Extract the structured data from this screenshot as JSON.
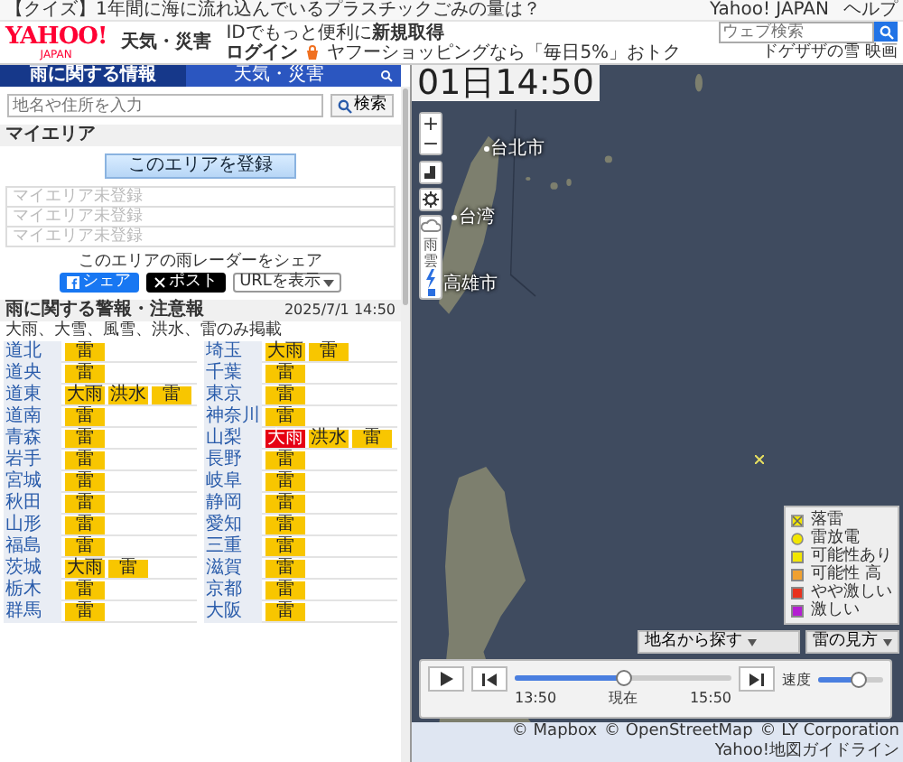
{
  "top_bar": {
    "headline": "【クイズ】1年間に海に流れ込んでいるプラスチックごみの量は？",
    "links": [
      "Yahoo! JAPAN",
      "ヘルプ"
    ]
  },
  "header": {
    "logo": "YAHOO!",
    "logo_sub": "JAPAN",
    "service": "天気・災害",
    "promo": "IDでもっと便利に",
    "promo_link": "新規取得",
    "login": "ログイン",
    "shopping": "ヤフーショッピングなら「毎日5%」おトク",
    "search": {
      "placeholder": "ウェブ検索",
      "suggestion": "ドゲザザの雪 映画"
    }
  },
  "sidebar": {
    "tabs": [
      {
        "label": "雨に関する情報",
        "selected": true
      },
      {
        "label": "天気・災害",
        "selected": false
      }
    ],
    "search": {
      "placeholder": "地名や住所を入力",
      "button": "検索"
    },
    "my_area": {
      "title": "マイエリア",
      "register_button": "このエリアを登録",
      "slots": [
        "マイエリア未登録",
        "マイエリア未登録",
        "マイエリア未登録"
      ]
    },
    "share": {
      "title": "このエリアの雨レーダーをシェア",
      "buttons": [
        {
          "kind": "facebook",
          "label": "シェア"
        },
        {
          "kind": "x",
          "label": "ポスト"
        },
        {
          "kind": "url",
          "label": "URLを表示"
        }
      ]
    },
    "warnings": {
      "title": "雨に関する警報・注意報",
      "timestamp": "2025/7/1 14:50",
      "note": "大雨、大雪、風雪、洪水、雷のみ掲載",
      "rows": [
        {
          "area": "道北",
          "alerts": [
            {
              "label": "雷",
              "color": "#f8c600"
            }
          ]
        },
        {
          "area": "道央",
          "alerts": [
            {
              "label": "雷",
              "color": "#f8c600"
            }
          ]
        },
        {
          "area": "道東",
          "alerts": [
            {
              "label": "大雨",
              "color": "#f8c600"
            },
            {
              "label": "洪水",
              "color": "#f8c600"
            },
            {
              "label": "雷",
              "color": "#f8c600"
            }
          ]
        },
        {
          "area": "道南",
          "alerts": [
            {
              "label": "雷",
              "color": "#f8c600"
            }
          ]
        },
        {
          "area": "青森",
          "alerts": [
            {
              "label": "雷",
              "color": "#f8c600"
            }
          ]
        },
        {
          "area": "岩手",
          "alerts": [
            {
              "label": "雷",
              "color": "#f8c600"
            }
          ]
        },
        {
          "area": "宮城",
          "alerts": [
            {
              "label": "雷",
              "color": "#f8c600"
            }
          ]
        },
        {
          "area": "秋田",
          "alerts": [
            {
              "label": "雷",
              "color": "#f8c600"
            }
          ]
        },
        {
          "area": "山形",
          "alerts": [
            {
              "label": "雷",
              "color": "#f8c600"
            }
          ]
        },
        {
          "area": "福島",
          "alerts": [
            {
              "label": "雷",
              "color": "#f8c600"
            }
          ]
        },
        {
          "area": "茨城",
          "alerts": [
            {
              "label": "大雨",
              "color": "#f8c600"
            },
            {
              "label": "雷",
              "color": "#f8c600"
            }
          ]
        },
        {
          "area": "栃木",
          "alerts": [
            {
              "label": "雷",
              "color": "#f8c600"
            }
          ]
        },
        {
          "area": "群馬",
          "alerts": [
            {
              "label": "雷",
              "color": "#f8c600"
            }
          ]
        },
        {
          "area": "埼玉",
          "alerts": [
            {
              "label": "大雨",
              "color": "#f8c600"
            },
            {
              "label": "雷",
              "color": "#f8c600"
            }
          ]
        },
        {
          "area": "千葉",
          "alerts": [
            {
              "label": "雷",
              "color": "#f8c600"
            }
          ]
        },
        {
          "area": "東京",
          "alerts": [
            {
              "label": "雷",
              "color": "#f8c600"
            }
          ]
        },
        {
          "area": "神奈川",
          "alerts": [
            {
              "label": "雷",
              "color": "#f8c600"
            }
          ]
        },
        {
          "area": "山梨",
          "alerts": [
            {
              "label": "大雨",
              "color": "#e60012"
            },
            {
              "label": "洪水",
              "color": "#f8c600"
            },
            {
              "label": "雷",
              "color": "#f8c600"
            }
          ]
        },
        {
          "area": "長野",
          "alerts": [
            {
              "label": "雷",
              "color": "#f8c600"
            }
          ]
        },
        {
          "area": "岐阜",
          "alerts": [
            {
              "label": "雷",
              "color": "#f8c600"
            }
          ]
        },
        {
          "area": "静岡",
          "alerts": [
            {
              "label": "雷",
              "color": "#f8c600"
            }
          ]
        },
        {
          "area": "愛知",
          "alerts": [
            {
              "label": "雷",
              "color": "#f8c600"
            }
          ]
        },
        {
          "area": "三重",
          "alerts": [
            {
              "label": "雷",
              "color": "#f8c600"
            }
          ]
        },
        {
          "area": "滋賀",
          "alerts": [
            {
              "label": "雷",
              "color": "#f8c600"
            }
          ]
        },
        {
          "area": "京都",
          "alerts": [
            {
              "label": "雷",
              "color": "#f8c600"
            }
          ]
        },
        {
          "area": "大阪",
          "alerts": [
            {
              "label": "雷",
              "color": "#f8c600"
            }
          ]
        }
      ]
    }
  },
  "map": {
    "time": "01日14:50",
    "zoom_buttons": [
      "+",
      "−"
    ],
    "layers": [
      {
        "kind": "rain-cloud",
        "label": "雨雲",
        "selected": false
      },
      {
        "kind": "lightning",
        "selected": true
      }
    ],
    "labels": [
      "台北市",
      "台湾",
      "高雄市"
    ],
    "legend": [
      {
        "kind": "strike",
        "label": "落雷"
      },
      {
        "kind": "discharge",
        "label": "雷放電"
      },
      {
        "kind": "square",
        "label": "可能性あり",
        "color": "#f2e600"
      },
      {
        "kind": "square",
        "label": "可能性 高",
        "color": "#f0a030"
      },
      {
        "kind": "square",
        "label": "やや激しい",
        "color": "#e8321e"
      },
      {
        "kind": "square",
        "label": "激しい",
        "color": "#b41ed2"
      }
    ],
    "place_search": "地名から探す",
    "legend_button": "雷の見方",
    "playback": {
      "start": "13:50",
      "now": "現在",
      "end": "15:50",
      "level": 0.5,
      "speed_label": "速度",
      "speed": {
        "level": 0.6
      }
    },
    "attribution": [
      "© Mapbox",
      "© OpenStreetMap",
      "© LY Corporation",
      "Yahoo!地図ガイドライン"
    ]
  }
}
